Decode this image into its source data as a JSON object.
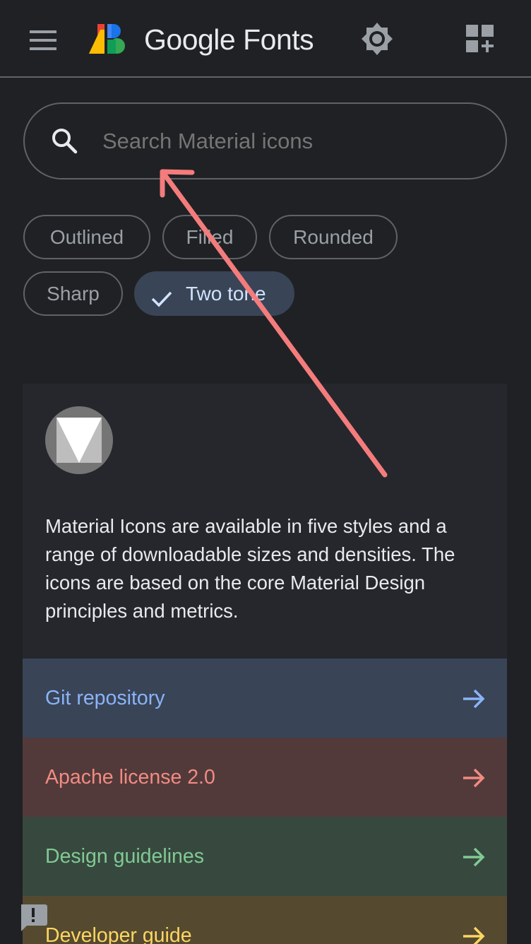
{
  "header": {
    "brand": "Google Fonts"
  },
  "search": {
    "placeholder": "Search Material icons"
  },
  "chips": [
    {
      "label": "Outlined",
      "selected": false
    },
    {
      "label": "Filled",
      "selected": false
    },
    {
      "label": "Rounded",
      "selected": false
    },
    {
      "label": "Sharp",
      "selected": false
    },
    {
      "label": "Two tone",
      "selected": true
    }
  ],
  "card": {
    "description": "Material Icons are available in five styles and a range of downloadable sizes and densities. The icons are based on the core Material Design principles and metrics.",
    "links": [
      {
        "label": "Git repository",
        "bg": "#394457",
        "fg": "#8ab4f8"
      },
      {
        "label": "Apache license 2.0",
        "bg": "#523a3b",
        "fg": "#f28b82"
      },
      {
        "label": "Design guidelines",
        "bg": "#37493e",
        "fg": "#81c995"
      },
      {
        "label": "Developer guide",
        "bg": "#554a2f",
        "fg": "#fdd663"
      }
    ]
  },
  "icons": {
    "menu": "menu-icon",
    "theme": "brightness-icon",
    "apps": "dashboard-customize-icon",
    "search": "search-icon",
    "check": "check-icon",
    "arrow": "arrow-forward-icon",
    "feedback": "feedback-icon"
  },
  "annotation": {
    "type": "arrow",
    "color": "#f47c7c"
  }
}
